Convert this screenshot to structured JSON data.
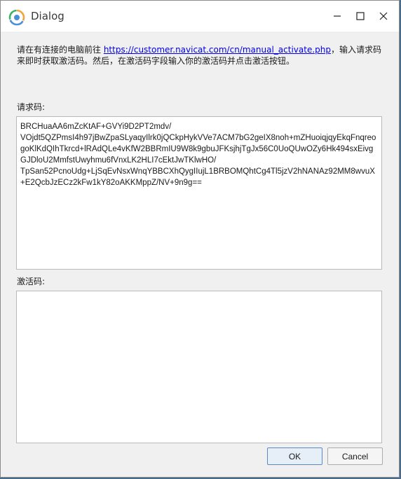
{
  "window": {
    "title": "Dialog"
  },
  "instructions": {
    "prefix": "请在有连接的电脑前往 ",
    "link": "https://customer.navicat.com/cn/manual_activate.php",
    "suffix": "，输入请求码来即时获取激活码。然后，在激活码字段输入你的激活码并点击激活按钮。"
  },
  "request_code": {
    "label": "请求码:",
    "value": "BRCHuaAA6mZcKtAF+GVYi9D2PT2mdv/\nVOjdt5QZPmsI4h97jBwZpaSLyaqyIlrk0jQCkpHykVVe7ACM7bG2geIX8noh+mZHuoiqjqyEkqFnqreogoKlKdQIhTkrcd+lRAdQLe4vKfW2BBRmIU9W8k9gbuJFKsjhjTgJx56C0UoQUwOZy6Hk494sxEivgGJDloU2MmfstUwyhmu6fVnxLK2HLI7cEktJwTKlwHO/\nTpSan52PcnoUdg+LjSqEvNsxWnqYBBCXhQygIIujL1BRBOMQhtCg4Tl5jzV2hNANAz92MM8wvuX+E2QcbJzECz2kFw1kY82oAKKMppZ/NV+9n9g=="
  },
  "activation_code": {
    "label": "激活码:",
    "value": ""
  },
  "buttons": {
    "ok": "OK",
    "cancel": "Cancel"
  },
  "colors": {
    "link": "#0000ee",
    "ok_border": "#5a8ac6",
    "window_bg": "#f0f0f0"
  }
}
